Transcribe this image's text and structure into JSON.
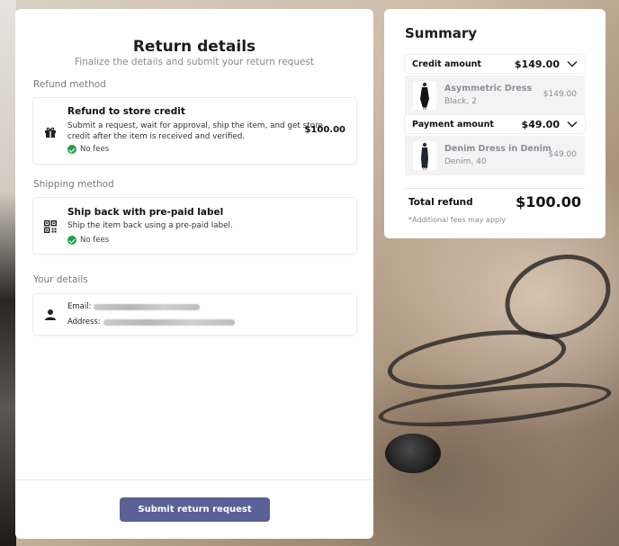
{
  "return_details": {
    "title": "Return details",
    "subtitle": "Finalize the details and submit your return request"
  },
  "refund_method": {
    "section_label": "Refund method",
    "option": {
      "title": "Refund to store credit",
      "description_line1": "Submit a request, wait for approval, ship the item, and get store",
      "description_line2": "credit after the item is received and verified.",
      "fee": "No fees",
      "price": "$100.00",
      "icon": "gift-icon"
    }
  },
  "shipping_method": {
    "section_label": "Shipping method",
    "option": {
      "title": "Ship back with pre-paid label",
      "description": "Ship the item back using a pre-paid label.",
      "fee": "No fees",
      "icon": "qr-code-icon"
    }
  },
  "your_details": {
    "section_label": "Your details",
    "email_label": "Email:",
    "address_label": "Address:",
    "icon": "user-icon"
  },
  "submit_button": "Submit return request",
  "summary": {
    "title": "Summary",
    "credit": {
      "label": "Credit amount",
      "amount": "$149.00",
      "item": {
        "name": "Asymmetric Dress",
        "variant": "Black, 2",
        "price": "$149.00"
      }
    },
    "payment": {
      "label": "Payment amount",
      "amount": "$49.00",
      "item": {
        "name": "Denim Dress in Denim",
        "variant": "Denim, 40",
        "price": "$49.00"
      }
    },
    "total_label": "Total refund",
    "total_amount": "$100.00",
    "fees_note": "*Additional fees may apply"
  },
  "colors": {
    "accent_button": "#5a6196",
    "check_green": "#21a04b",
    "muted_text": "#8d8d98"
  }
}
